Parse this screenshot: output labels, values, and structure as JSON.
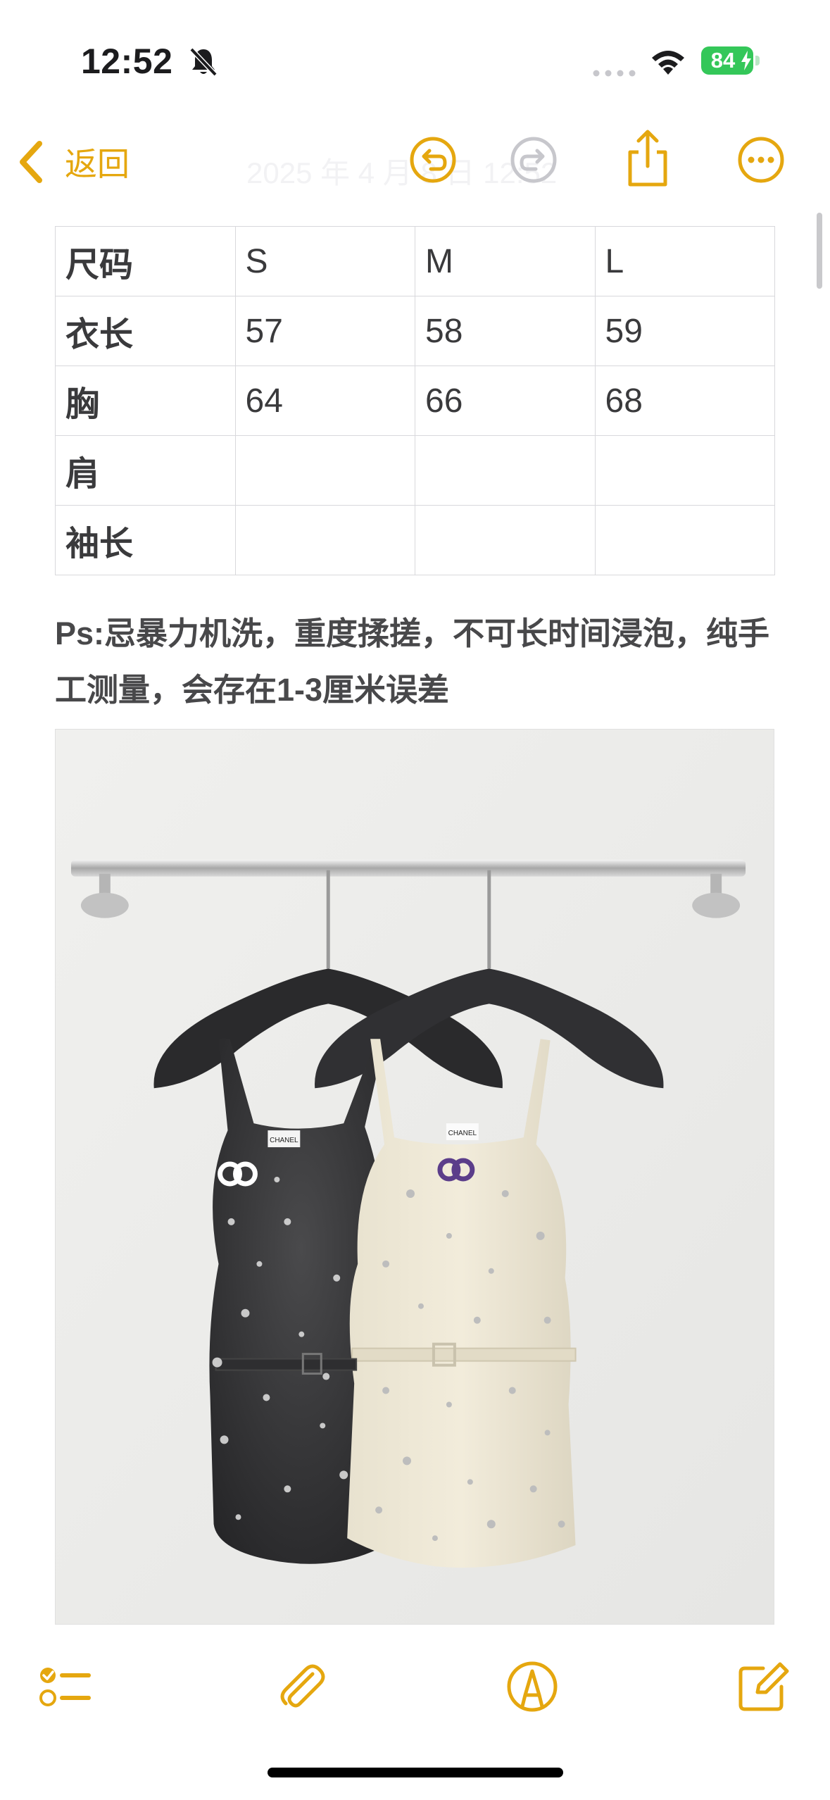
{
  "status_bar": {
    "time": "12:52",
    "battery_level": "84",
    "icons": [
      "bell-slash-icon",
      "signal-icon",
      "wifi-icon",
      "battery-charging-icon"
    ]
  },
  "nav": {
    "back_label": "返回",
    "faded_title": "2025 年 4 月 8 日  12:52",
    "accent_color": "#e5a70f",
    "icons": [
      "undo-icon",
      "redo-icon",
      "share-icon",
      "more-icon"
    ]
  },
  "size_table": {
    "headers": [
      "尺码",
      "S",
      "M",
      "L"
    ],
    "rows": [
      [
        "衣长",
        "57",
        "58",
        "59"
      ],
      [
        "胸",
        "64",
        "66",
        "68"
      ],
      [
        "肩",
        "",
        "",
        ""
      ],
      [
        "袖长",
        "",
        "",
        ""
      ]
    ]
  },
  "note_text": "Ps:忌暴力机洗，重度揉搓，不可长时间浸泡，纯手工测量，会存在1-3厘米误差",
  "photo": {
    "label_left": "CHANEL",
    "label_right": "CHANEL"
  },
  "toolbar": {
    "icons": [
      "checklist-icon",
      "paperclip-icon",
      "markup-pen-icon",
      "compose-icon"
    ]
  }
}
